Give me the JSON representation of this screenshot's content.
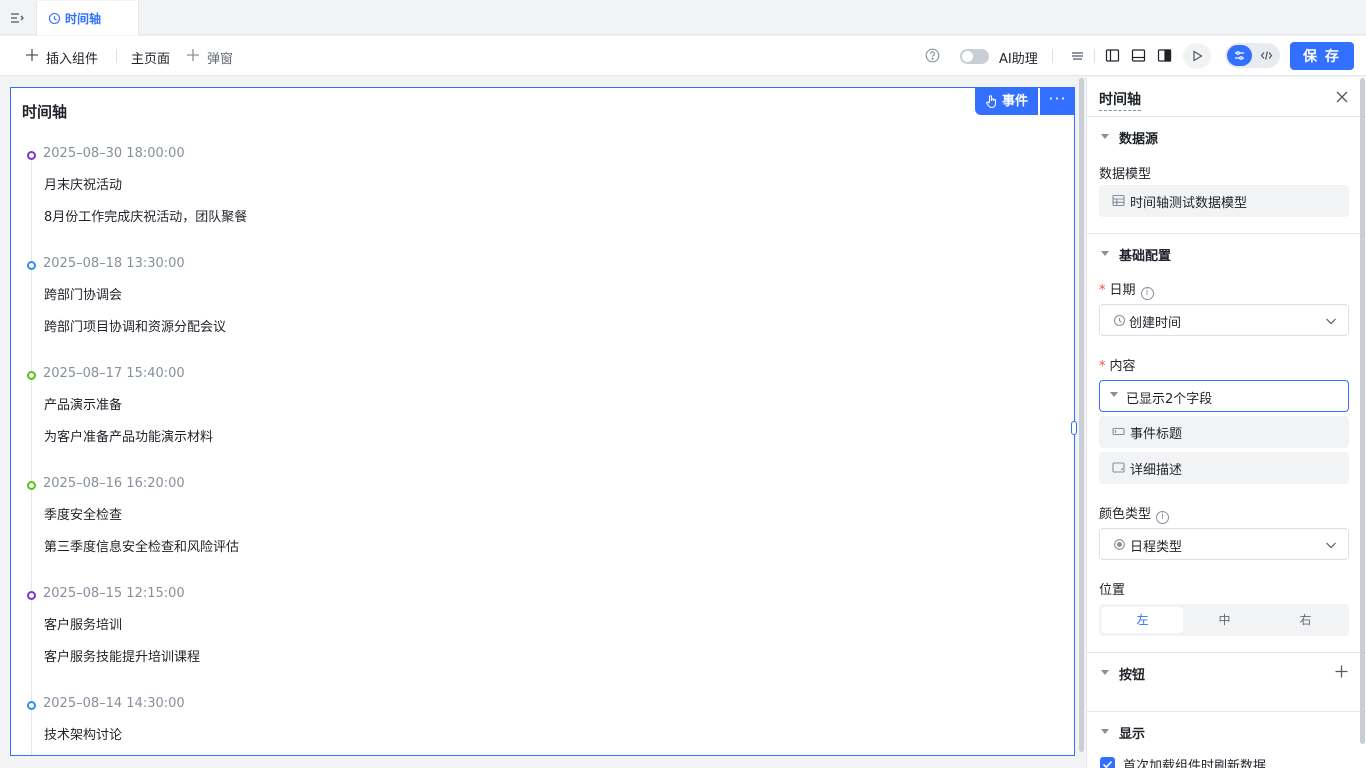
{
  "tab": {
    "label": "时间轴"
  },
  "toolbar": {
    "insert_component": "插入组件",
    "main_page": "主页面",
    "popup": "弹窗",
    "ai_assistant": "AI助理",
    "save": "保 存"
  },
  "canvas": {
    "title": "时间轴",
    "event_button": "事件",
    "more_button": "···"
  },
  "timeline": {
    "items": [
      {
        "time": "2025–08–30 18:00:00",
        "title": "月末庆祝活动",
        "desc": "8月份工作完成庆祝活动，团队聚餐",
        "color": "#7a35c8"
      },
      {
        "time": "2025–08–18 13:30:00",
        "title": "跨部门协调会",
        "desc": "跨部门项目协调和资源分配会议",
        "color": "#2f8ef0"
      },
      {
        "time": "2025–08–17 15:40:00",
        "title": "产品演示准备",
        "desc": "为客户准备产品功能演示材料",
        "color": "#52c41a"
      },
      {
        "time": "2025–08–16 16:20:00",
        "title": "季度安全检查",
        "desc": "第三季度信息安全检查和风险评估",
        "color": "#52c41a"
      },
      {
        "time": "2025–08–15 12:15:00",
        "title": "客户服务培训",
        "desc": "客户服务技能提升培训课程",
        "color": "#7a35c8"
      },
      {
        "time": "2025–08–14 14:30:00",
        "title": "技术架构讨论",
        "desc": "",
        "color": "#2f8ef0"
      }
    ]
  },
  "panel": {
    "title": "时间轴",
    "datasource": {
      "heading": "数据源",
      "model_label": "数据模型",
      "model_value": "时间轴测试数据模型"
    },
    "basic": {
      "heading": "基础配置",
      "date_label": "日期",
      "date_value": "创建时间",
      "content_label": "内容",
      "content_value": "已显示2个字段",
      "fields": [
        "事件标题",
        "详细描述"
      ],
      "color_type_label": "颜色类型",
      "color_type_value": "日程类型",
      "position_label": "位置",
      "position_options": [
        "左",
        "中",
        "右"
      ],
      "required_mark": "*",
      "info_mark": "i"
    },
    "buttons": {
      "heading": "按钮"
    },
    "display": {
      "heading": "显示",
      "refresh_on_load": "首次加载组件时刷新数据"
    }
  }
}
